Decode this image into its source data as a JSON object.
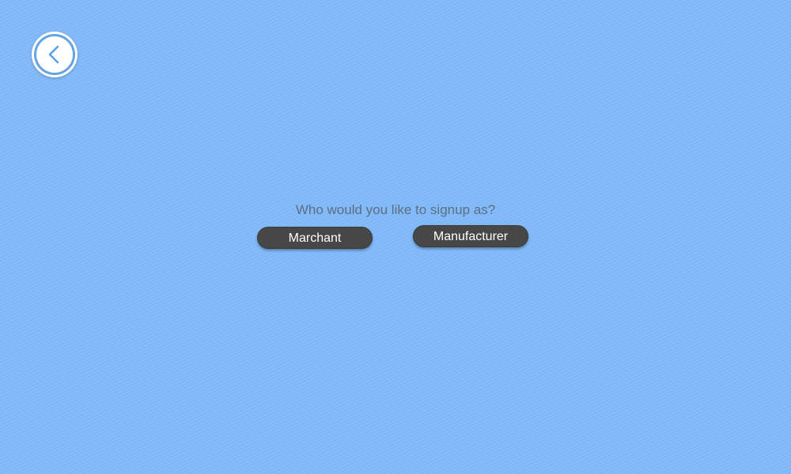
{
  "nav": {
    "back_icon": "chevron-left-icon"
  },
  "signup": {
    "prompt": "Who would you like to signup as?",
    "options": [
      {
        "label": "Marchant"
      },
      {
        "label": "Manufacturer"
      }
    ]
  },
  "colors": {
    "background": "#7fb8f8",
    "button": "#474747",
    "button_text": "#ffffff",
    "prompt_text": "#5d6e80",
    "back_ring": "#63a5e4"
  }
}
